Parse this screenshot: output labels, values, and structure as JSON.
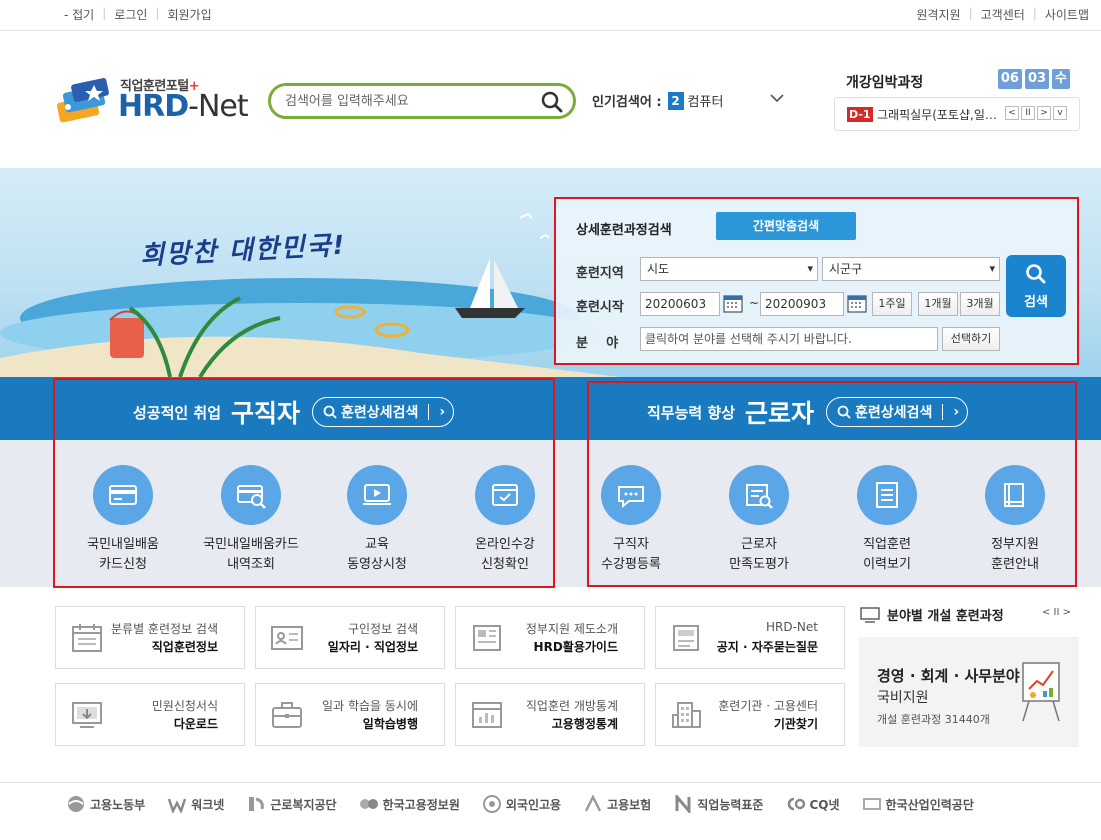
{
  "topbar": {
    "left": [
      "- 접기",
      "로그인",
      "회원가입"
    ],
    "right": [
      "원격지원",
      "고객센터",
      "사이트맵"
    ]
  },
  "logo": {
    "sub": "직업훈련포털",
    "plus": "+",
    "main_a": "HRD",
    "main_b": "-Net"
  },
  "search": {
    "placeholder": "검색어를 입력해주세요"
  },
  "popular": {
    "label": "인기검색어 :",
    "rank": "2",
    "keyword": "컴퓨터"
  },
  "deadline": {
    "title": "개강임박과정",
    "month": "06",
    "day": "03",
    "weekday": "수",
    "dday": "D-1",
    "course": "그래픽실무(포토샵,일러스트)",
    "controls": [
      "<",
      "II",
      ">",
      "v"
    ]
  },
  "banner": {
    "slogan": "희망찬 대한민국!"
  },
  "advanced": {
    "title": "상세훈련과정검색",
    "quick_btn": "간편맞춤검색",
    "region_label": "훈련지역",
    "region1": "시도",
    "region2": "시군구",
    "start_label": "훈련시작",
    "date_from": "20200603",
    "tilde": "~",
    "date_to": "20200903",
    "p1": "1주일",
    "p2": "1개월",
    "p3": "3개월",
    "field_label": "분    야",
    "field_placeholder": "클릭하여 분야를 선택해 주시기 바랍니다.",
    "choose_btn": "선택하기",
    "search_btn": "검색"
  },
  "jobseeker": {
    "pre": "성공적인 취업",
    "big": "구직자",
    "pill": "훈련상세검색",
    "tiles": [
      {
        "t1": "국민내일배움",
        "t2": "카드신청",
        "icon": "card-icon"
      },
      {
        "t1": "국민내일배움카드",
        "t2": "내역조회",
        "icon": "card-search-icon"
      },
      {
        "t1": "교육",
        "t2": "동영상시청",
        "icon": "video-icon"
      },
      {
        "t1": "온라인수강",
        "t2": "신청확인",
        "icon": "online-check-icon"
      }
    ]
  },
  "worker": {
    "pre": "직무능력 향상",
    "big": "근로자",
    "pill": "훈련상세검색",
    "tiles": [
      {
        "t1": "구직자",
        "t2": "수강평등록",
        "icon": "chat-icon"
      },
      {
        "t1": "근로자",
        "t2": "만족도평가",
        "icon": "survey-icon"
      },
      {
        "t1": "직업훈련",
        "t2": "이력보기",
        "icon": "history-icon"
      },
      {
        "t1": "정부지원",
        "t2": "훈련안내",
        "icon": "book-icon"
      }
    ]
  },
  "quicklinks": [
    {
      "s1": "분류별 훈련정보 검색",
      "s2": "직업훈련정보",
      "icon": "calendar-icon"
    },
    {
      "s1": "구인정보 검색",
      "s2": "일자리 · 직업정보",
      "icon": "id-card-icon"
    },
    {
      "s1": "정부지원 제도소개",
      "s2": "HRD활용가이드",
      "icon": "newspaper-icon"
    },
    {
      "s1": "HRD-Net",
      "s2": "공지 · 자주묻는질문",
      "icon": "document-icon"
    },
    {
      "s1": "민원신청서식",
      "s2": "다운로드",
      "icon": "download-icon"
    },
    {
      "s1": "일과 학습을 동시에",
      "s2": "일학습병행",
      "icon": "briefcase-icon"
    },
    {
      "s1": "직업훈련 개방통계",
      "s2": "고용행정통계",
      "icon": "stats-icon"
    },
    {
      "s1": "훈련기관 · 고용센터",
      "s2": "기관찾기",
      "icon": "building-icon"
    }
  ],
  "field_courses": {
    "title": "분야별 개설 훈련과정",
    "ctrl": "< II >",
    "c1": "경영 · 회계 · 사무분야",
    "c2": "국비지원",
    "c3": "개설 훈련과정 31440개"
  },
  "orgs": [
    "고용노동부",
    "워크넷",
    "근로복지공단",
    "한국고용정보원",
    "외국인고용",
    "고용보험",
    "직업능력표준",
    "CQ넷",
    "한국산업인력공단"
  ],
  "colors": {
    "brand_blue": "#1a7abf",
    "search_green": "#7bac3a",
    "alert_red": "#e0161e"
  }
}
